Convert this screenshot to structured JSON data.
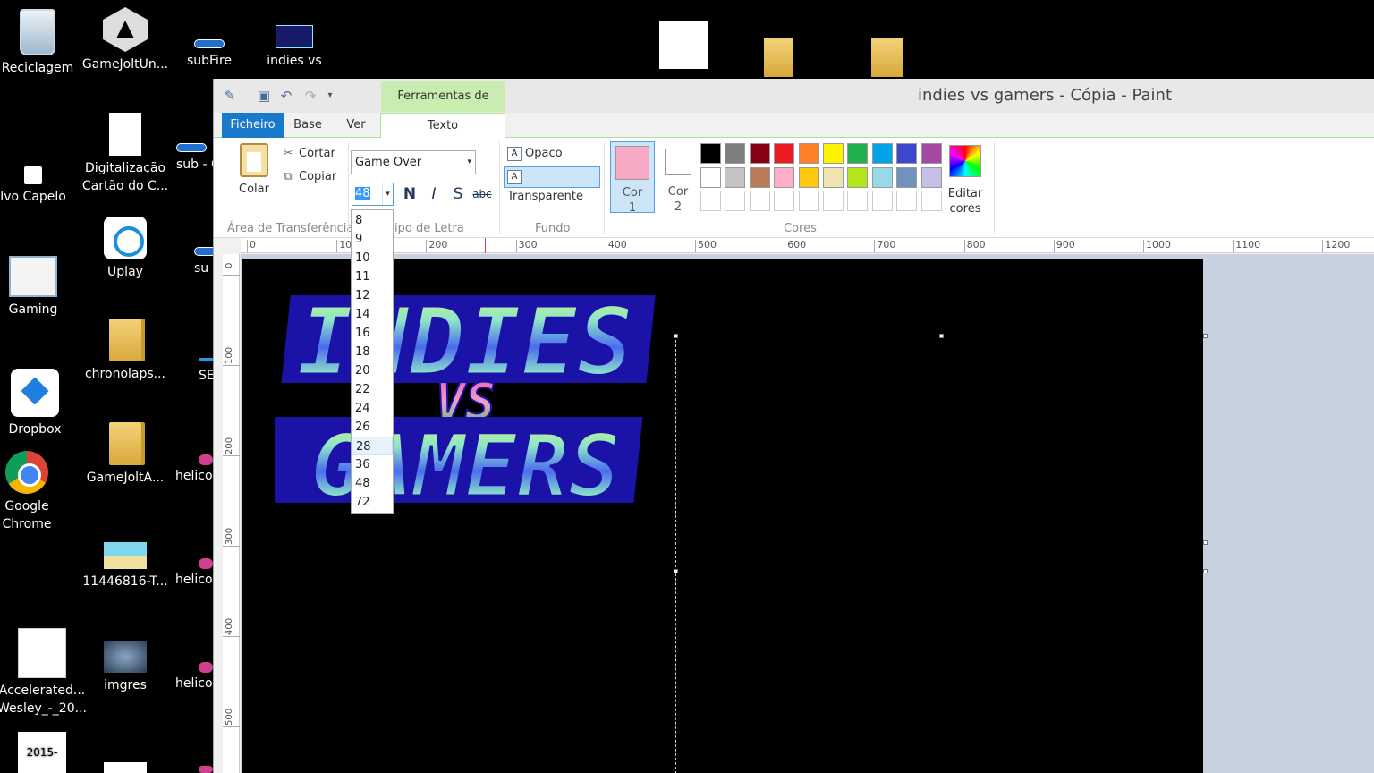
{
  "desktop": {
    "icons": [
      {
        "label": "Reciclagem"
      },
      {
        "label": "GameJoltUn..."
      },
      {
        "label": "subFire"
      },
      {
        "label": "indies vs"
      },
      {
        "label": "Ivo Capelo"
      },
      {
        "label": "Digitalização\nCartão do C..."
      },
      {
        "label": "sub - C"
      },
      {
        "label": "Uplay"
      },
      {
        "label": "su"
      },
      {
        "label": "Gaming"
      },
      {
        "label": "chronolaps..."
      },
      {
        "label": "SE"
      },
      {
        "label": "Dropbox"
      },
      {
        "label": "GameJoltA..."
      },
      {
        "label": "helico"
      },
      {
        "label": "Google\nChrome"
      },
      {
        "label": "11446816-T..."
      },
      {
        "label": "helico"
      },
      {
        "label": "Accelerated...\nWesley_-_20..."
      },
      {
        "label": "imgres"
      },
      {
        "label": "helico"
      },
      {
        "label": "2015-07-"
      }
    ]
  },
  "paint": {
    "title": "indies vs gamers - Cópia - Paint",
    "context_tab": "Ferramentas de Texto",
    "tabs": {
      "ficheiro": "Ficheiro",
      "base": "Base",
      "ver": "Ver",
      "texto": "Texto"
    },
    "clipboard": {
      "paste": "Colar",
      "cut": "Cortar",
      "copy": "Copiar",
      "group": "Área de Transferência"
    },
    "font": {
      "family": "Game Over",
      "size": "48",
      "group": "ipo de Letra",
      "bold": "N",
      "italic": "I",
      "underline": "S",
      "strike": "abc"
    },
    "background": {
      "opaque": "Opaco",
      "transparent": "Transparente",
      "group": "Fundo",
      "selected": "Transparente"
    },
    "colors": {
      "color1_label": "Cor\n1",
      "color2_label": "Cor\n2",
      "color1": "#f7a8c4",
      "color2": "#ffffff",
      "group": "Cores",
      "edit": "Editar\ncores",
      "palette_row1": [
        "#000000",
        "#7f7f7f",
        "#880015",
        "#ed1c24",
        "#ff7f27",
        "#fff200",
        "#22b14c",
        "#00a2e8",
        "#3f48cc",
        "#a349a4"
      ],
      "palette_row2": [
        "#ffffff",
        "#c3c3c3",
        "#b97a57",
        "#ffaec9",
        "#ffc90e",
        "#efe4b0",
        "#b5e61d",
        "#99d9ea",
        "#7092be",
        "#c8bfe7"
      ]
    },
    "ruler_h": [
      "0",
      "100",
      "200",
      "300",
      "400",
      "500",
      "600",
      "700",
      "800",
      "900",
      "1000",
      "1100",
      "1200"
    ],
    "ruler_v": [
      "0",
      "100",
      "200",
      "300",
      "400",
      "500"
    ],
    "size_options": [
      "8",
      "9",
      "10",
      "11",
      "12",
      "14",
      "16",
      "18",
      "20",
      "22",
      "24",
      "26",
      "28",
      "36",
      "48",
      "72"
    ],
    "hovered_size": "28",
    "logo": {
      "line1": "INDIES",
      "line2": "VS",
      "line3": "GAMERS"
    }
  }
}
